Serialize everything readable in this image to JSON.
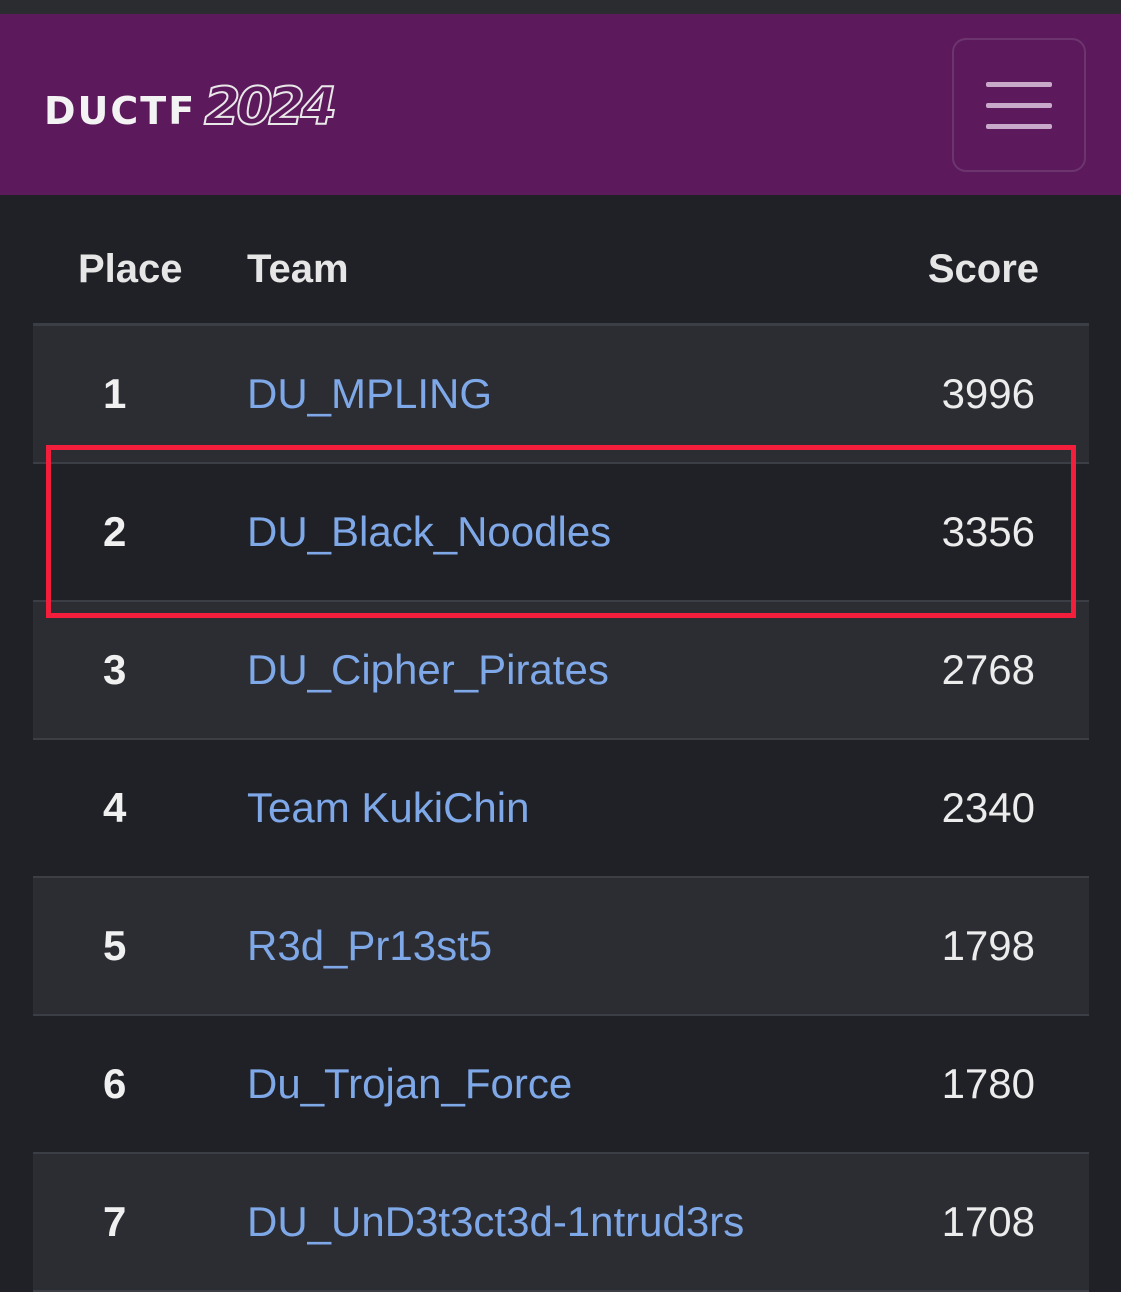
{
  "navbar": {
    "brand_text": "DUCTF",
    "brand_year": "2024",
    "menu_icon": "hamburger-menu-icon"
  },
  "table": {
    "headers": {
      "place": "Place",
      "team": "Team",
      "score": "Score"
    },
    "rows": [
      {
        "place": "1",
        "team": "DU_MPLING",
        "score": "3996"
      },
      {
        "place": "2",
        "team": "DU_Black_Noodles",
        "score": "3356"
      },
      {
        "place": "3",
        "team": "DU_Cipher_Pirates",
        "score": "2768"
      },
      {
        "place": "4",
        "team": "Team KukiChin",
        "score": "2340"
      },
      {
        "place": "5",
        "team": "R3d_Pr13st5",
        "score": "1798"
      },
      {
        "place": "6",
        "team": "Du_Trojan_Force",
        "score": "1780"
      },
      {
        "place": "7",
        "team": "DU_UnD3t3ct3d-1ntrud3rs",
        "score": "1708"
      }
    ]
  },
  "colors": {
    "navbar_bg": "#5c1a5c",
    "page_bg": "#1f2126",
    "row_alt_bg": "#2b2d33",
    "team_link": "#7fa8e8",
    "highlight_box": "#f21e3c"
  }
}
